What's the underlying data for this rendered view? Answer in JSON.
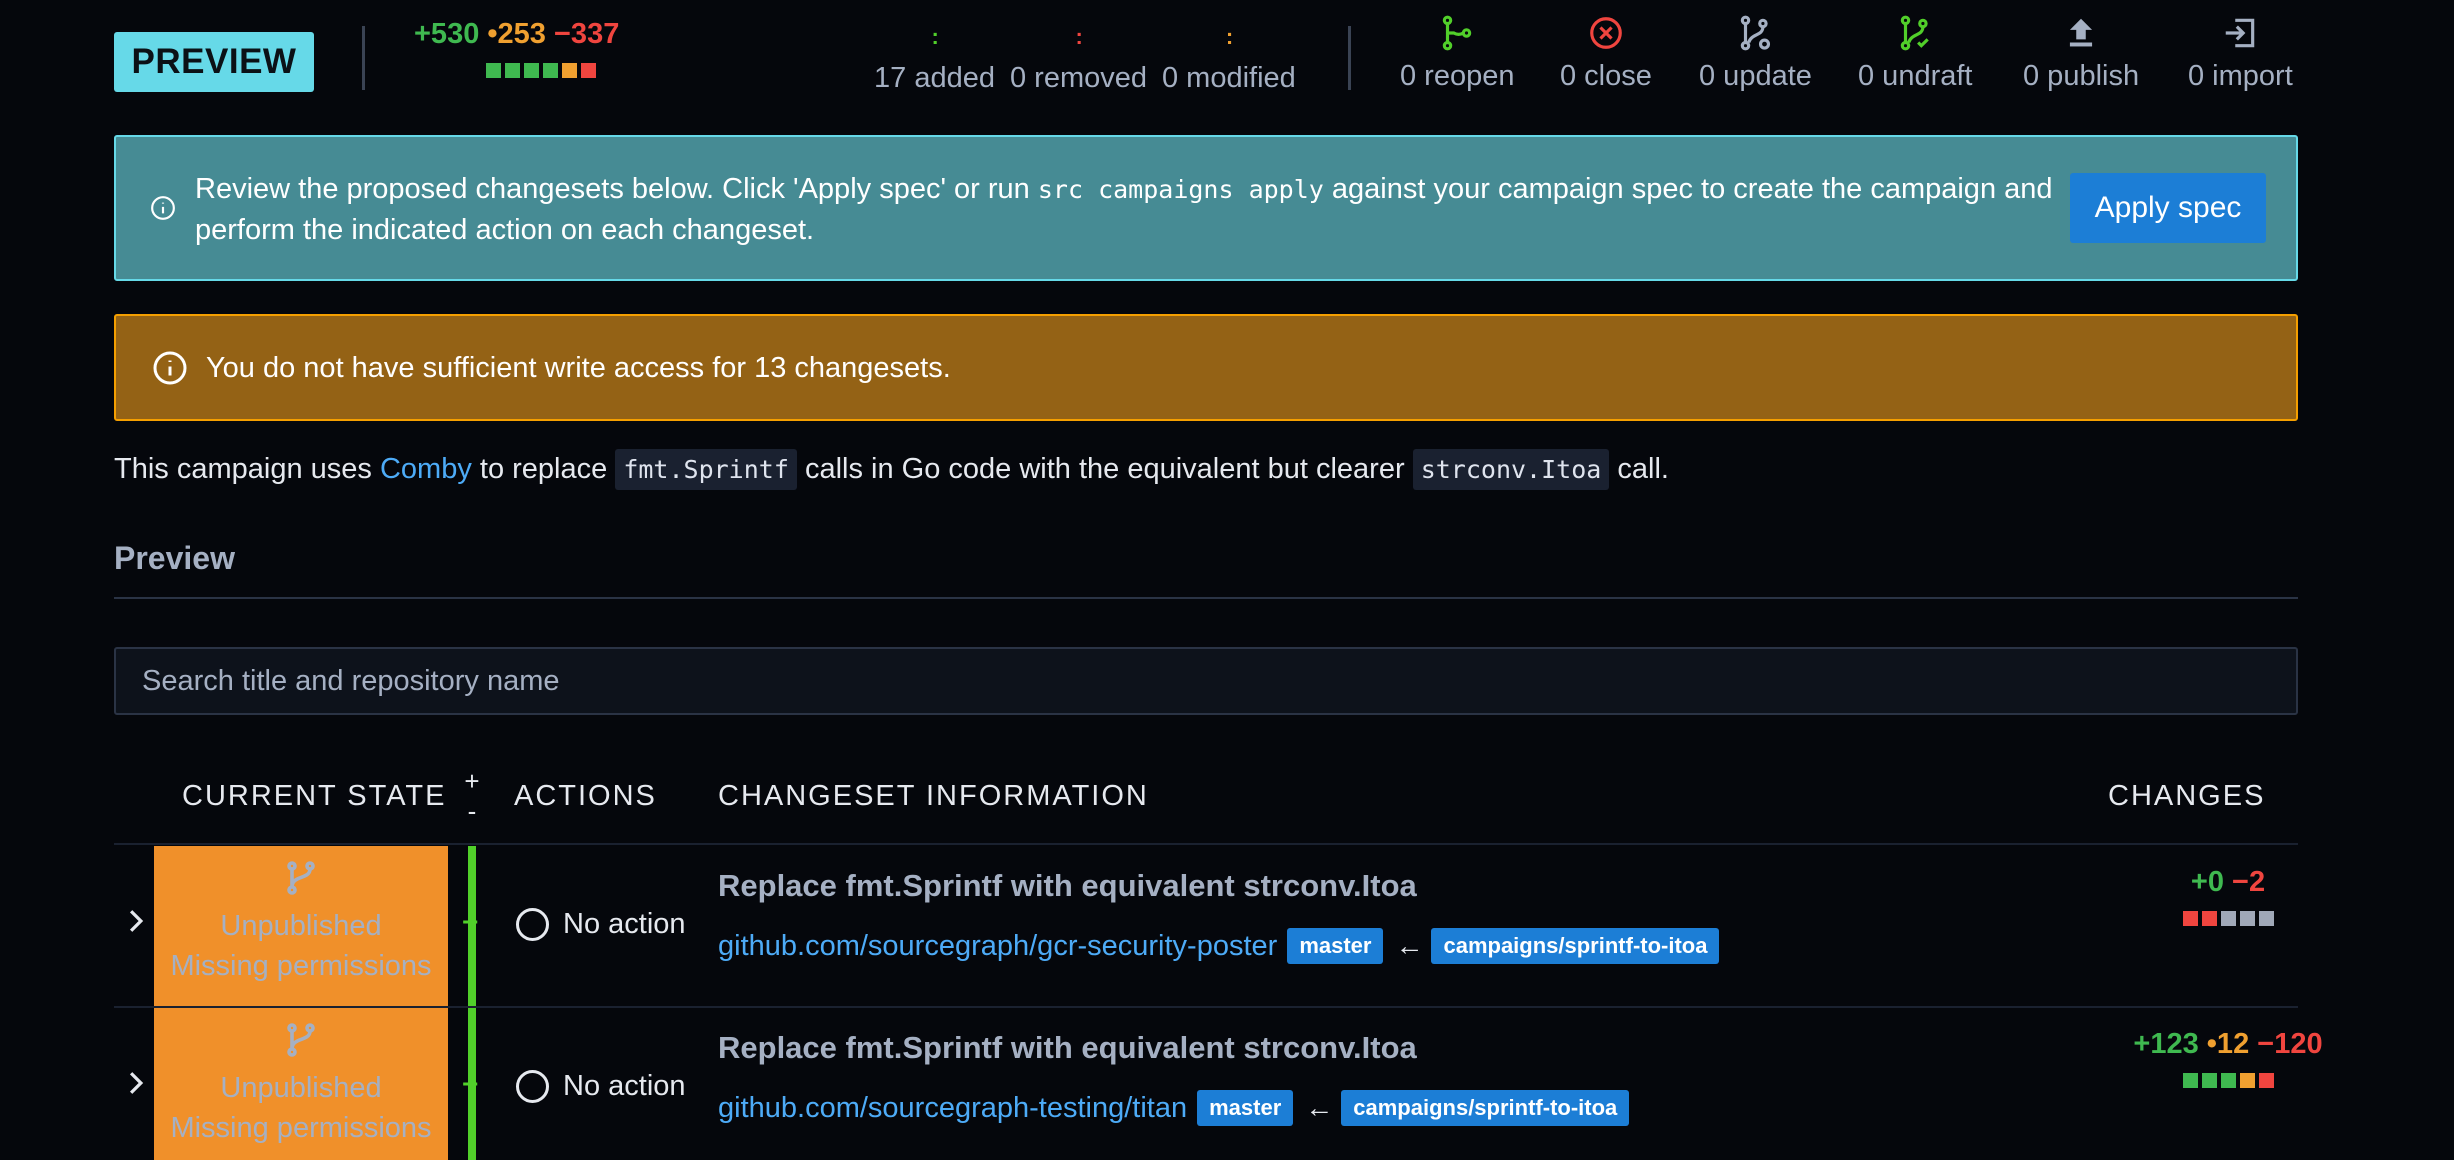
{
  "header": {
    "badge": "PREVIEW",
    "diffstat": {
      "added": "+530",
      "changed": "•253",
      "deleted": "−337",
      "squares": [
        "g",
        "g",
        "g",
        "g",
        "o",
        "r"
      ]
    },
    "counts": [
      {
        "glyph": "+",
        "label": "17 added",
        "color": "#51cf2a"
      },
      {
        "glyph": "-",
        "label": "0 removed",
        "color": "#f0453f"
      },
      {
        "glyph": "•",
        "label": "0 modified",
        "color": "#f0a030"
      }
    ],
    "actions": [
      {
        "icon": "git-reopen-icon",
        "label": "0 reopen"
      },
      {
        "icon": "close-circle-icon",
        "label": "0 close"
      },
      {
        "icon": "git-update-icon",
        "label": "0 update"
      },
      {
        "icon": "git-undraft-icon",
        "label": "0 undraft"
      },
      {
        "icon": "upload-icon",
        "label": "0 publish"
      },
      {
        "icon": "import-icon",
        "label": "0 import"
      }
    ]
  },
  "info_alert": {
    "text_before": "Review the proposed changesets below. Click 'Apply spec' or run ",
    "code": "src campaigns apply",
    "text_after": " against your campaign spec to create the campaign and perform the indicated action on each changeset.",
    "button": "Apply spec"
  },
  "warning_alert": {
    "text": "You do not have sufficient write access for 13 changesets."
  },
  "description": {
    "p1": "This campaign uses ",
    "link": "Comby",
    "p2": " to replace ",
    "code1": "fmt.Sprintf",
    "p3": " calls in Go code with the equivalent but clearer ",
    "code2": "strconv.Itoa",
    "p4": " call."
  },
  "section_title": "Preview",
  "search": {
    "placeholder": "Search title and repository name"
  },
  "table": {
    "headers": {
      "current_state": "CURRENT STATE",
      "plus": "+",
      "minus": "-",
      "actions": "ACTIONS",
      "info": "CHANGESET INFORMATION",
      "changes": "CHANGES"
    },
    "rows": [
      {
        "state1": "Unpublished",
        "state2": "Missing permissions",
        "delta": "+",
        "action": "No action",
        "title": "Replace fmt.Sprintf with equivalent strconv.Itoa",
        "repo": "github.com/sourcegraph/gcr-security-poster",
        "base": "master",
        "arrow": "←",
        "head": "campaigns/sprintf-to-itoa",
        "added": "+0",
        "changed": "",
        "deleted": "−2",
        "squares": [
          "r",
          "r",
          "n",
          "n",
          "n"
        ]
      },
      {
        "state1": "Unpublished",
        "state2": "Missing permissions",
        "delta": "+",
        "action": "No action",
        "title": "Replace fmt.Sprintf with equivalent strconv.Itoa",
        "repo": "github.com/sourcegraph-testing/titan",
        "base": "master",
        "arrow": "←",
        "head": "campaigns/sprintf-to-itoa",
        "added": "+123",
        "changed": "•12",
        "deleted": "−120",
        "squares": [
          "g",
          "g",
          "g",
          "o",
          "r"
        ]
      }
    ]
  }
}
